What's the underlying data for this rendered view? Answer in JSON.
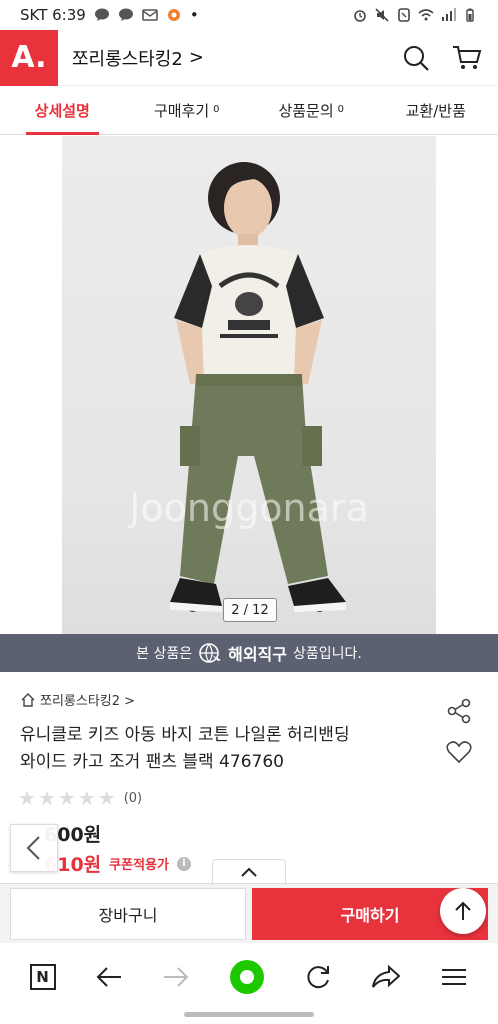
{
  "status_bar": {
    "carrier_time": "SKT 6:39",
    "dot": "•"
  },
  "header": {
    "logo": "A.",
    "store_name": "쪼리롱스타킹2",
    "chevron": ">"
  },
  "tabs": [
    {
      "label": "상세설명",
      "count": ""
    },
    {
      "label": "구매후기",
      "count": "0"
    },
    {
      "label": "상품문의",
      "count": "0"
    },
    {
      "label": "교환/반품",
      "count": ""
    }
  ],
  "gallery": {
    "counter": "2 / 12",
    "watermark": "Joonggonara"
  },
  "banner": {
    "prefix": "본 상품은",
    "highlight": "해외직구",
    "suffix": "상품입니다."
  },
  "product": {
    "breadcrumb": "쪼리롱스타킹2 >",
    "title_line1": "유니클로 키즈 아동 바지 코튼 나일론 허리밴딩",
    "title_line2": "와이드 카고 조거 팬츠 블랙 476760",
    "rating_count": "(0)",
    "rating": 0,
    "price_original": "600원",
    "price_coupon": "610원",
    "coupon_label": "쿠폰적용가",
    "info_icon": "i"
  },
  "buttons": {
    "cart": "장바구니",
    "buy": "구매하기"
  },
  "browser_nav": {
    "n_label": "N"
  },
  "colors": {
    "accent": "#e8323c",
    "banner": "#5b6170",
    "green": "#1ec800"
  }
}
